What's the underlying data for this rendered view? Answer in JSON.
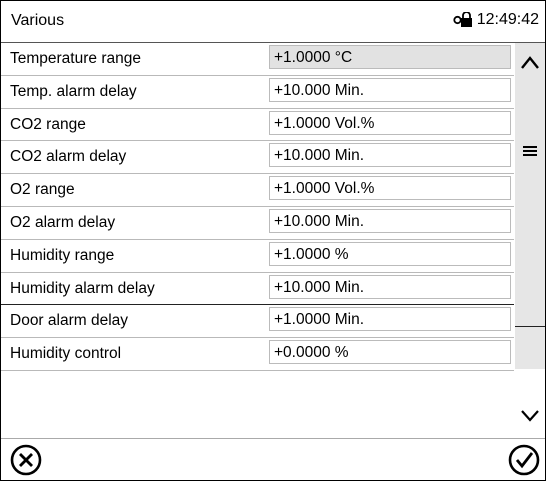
{
  "header": {
    "title": "Various",
    "time": "12:49:42",
    "lock_icon": "lock-icon"
  },
  "rows": [
    {
      "label": "Temperature range",
      "value": "+1.0000 °C",
      "readonly": true
    },
    {
      "label": "Temp. alarm delay",
      "value": "+10.000 Min."
    },
    {
      "label": "CO2 range",
      "value": "+1.0000 Vol.%"
    },
    {
      "label": "CO2 alarm delay",
      "value": "+10.000 Min."
    },
    {
      "label": "O2 range",
      "value": "+1.0000 Vol.%"
    },
    {
      "label": "O2 alarm delay",
      "value": "+10.000 Min."
    },
    {
      "label": "Humidity range",
      "value": "+1.0000 %"
    },
    {
      "label": "Humidity alarm delay",
      "value": "+10.000 Min."
    },
    {
      "label": "Door alarm delay",
      "value": "+1.0000 Min."
    },
    {
      "label": "Humidity control",
      "value": "+0.0000 %"
    }
  ],
  "scrollbar": {
    "up_icon": "chevron-up-icon",
    "thumb_icon": "menu-lines-icon",
    "down_icon": "chevron-down-icon"
  },
  "footer": {
    "cancel_icon": "cancel-circle-icon",
    "confirm_icon": "confirm-check-icon"
  }
}
